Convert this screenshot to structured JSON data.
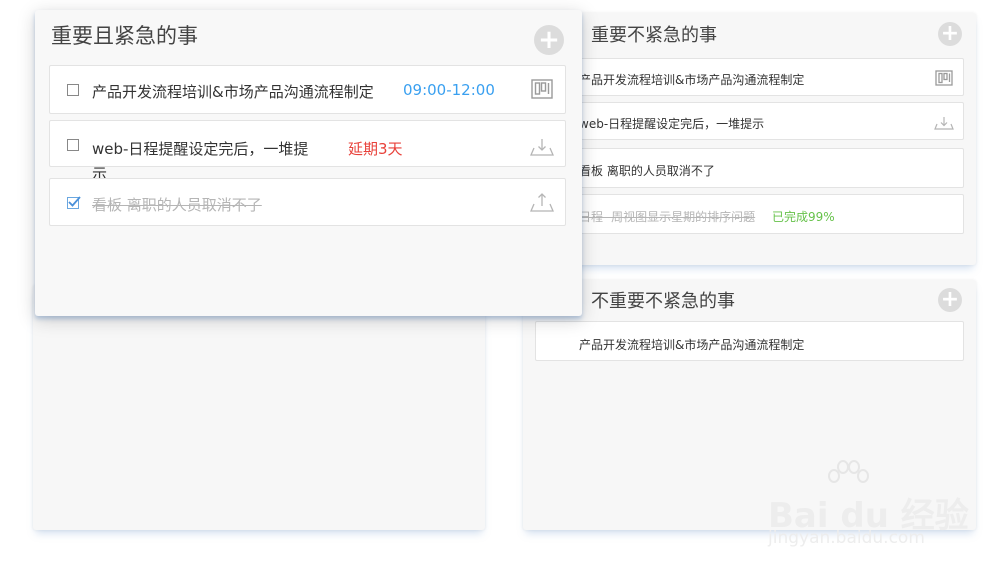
{
  "quadrants": {
    "important_urgent": {
      "title": "重要且紧急的事",
      "items": [
        {
          "checked": false,
          "text": "产品开发流程培训&市场产品沟通流程制定",
          "time": "09:00-12:00",
          "icon": "kanban-icon"
        },
        {
          "checked": false,
          "text": "web-日程提醒设定完后，一堆提",
          "text2": "示",
          "tag": "延期3天",
          "icon": "download-icon"
        },
        {
          "checked": true,
          "text": "看板 离职的人员取消不了",
          "icon": "upload-icon"
        }
      ]
    },
    "important_not_urgent": {
      "title": "重要不紧急的事",
      "items": [
        {
          "text": "产品开发流程培训&市场产品沟通流程制定",
          "icon": "kanban-icon"
        },
        {
          "text": "web-日程提醒设定完后，一堆提示",
          "icon": "download-icon"
        },
        {
          "text": "看板 离职的人员取消不了"
        },
        {
          "text": "日程- 周视图显示星期的排序问题",
          "status": "已完成99%"
        }
      ]
    },
    "not_important_not_urgent": {
      "title": "不重要不紧急的事",
      "items": [
        {
          "text": "产品开发流程培训&市场产品沟通流程制定"
        }
      ]
    }
  },
  "add_symbol": "+",
  "watermark": {
    "brand": "Bai du 经验",
    "url": "jingyan.baidu.com"
  },
  "colors": {
    "time": "#3aa0f0",
    "delay": "#e8413a",
    "done": "#66c24a",
    "card_bg": "#f7f7f7"
  }
}
